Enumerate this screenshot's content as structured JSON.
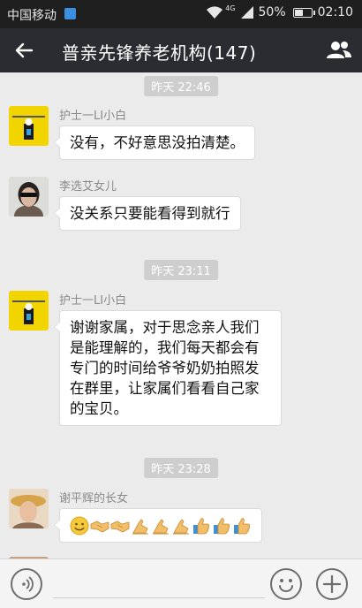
{
  "status_bar": {
    "carrier": "中国移动",
    "network": "4G",
    "battery": "50%",
    "battery_level": 0.5,
    "time": "02:10"
  },
  "header": {
    "title": "普亲先锋养老机构(147)"
  },
  "messages": [
    {
      "type": "time",
      "text": "昨天 22:46"
    },
    {
      "type": "msg",
      "sender": "护士一LI小白",
      "text": "没有，不好意思没拍清楚。"
    },
    {
      "type": "msg",
      "sender": "李选艾女儿",
      "text": "没关系只要能看得到就行"
    },
    {
      "type": "time",
      "text": "昨天 23:11"
    },
    {
      "type": "msg",
      "sender": "护士一LI小白",
      "lines": [
        "谢谢家属，对于思念亲人我们",
        "是能理解的，我们每天都会有",
        "专门的时间给爷爷奶奶拍照发",
        "在群里，让家属们看看自己家",
        "的宝贝。"
      ]
    },
    {
      "type": "time",
      "text": "昨天 23:28"
    },
    {
      "type": "msg",
      "sender": "谢平辉的长女",
      "emojis": [
        "smile",
        "handshake",
        "handshake",
        "strong",
        "strong",
        "strong",
        "thumbs-up",
        "thumbs-up",
        "thumbs-up"
      ]
    }
  ],
  "colors": {
    "header_bg": "#2a2c31",
    "chat_bg": "#ebebeb",
    "bubble_bg": "#ffffff",
    "time_badge_bg": "#cecece"
  }
}
